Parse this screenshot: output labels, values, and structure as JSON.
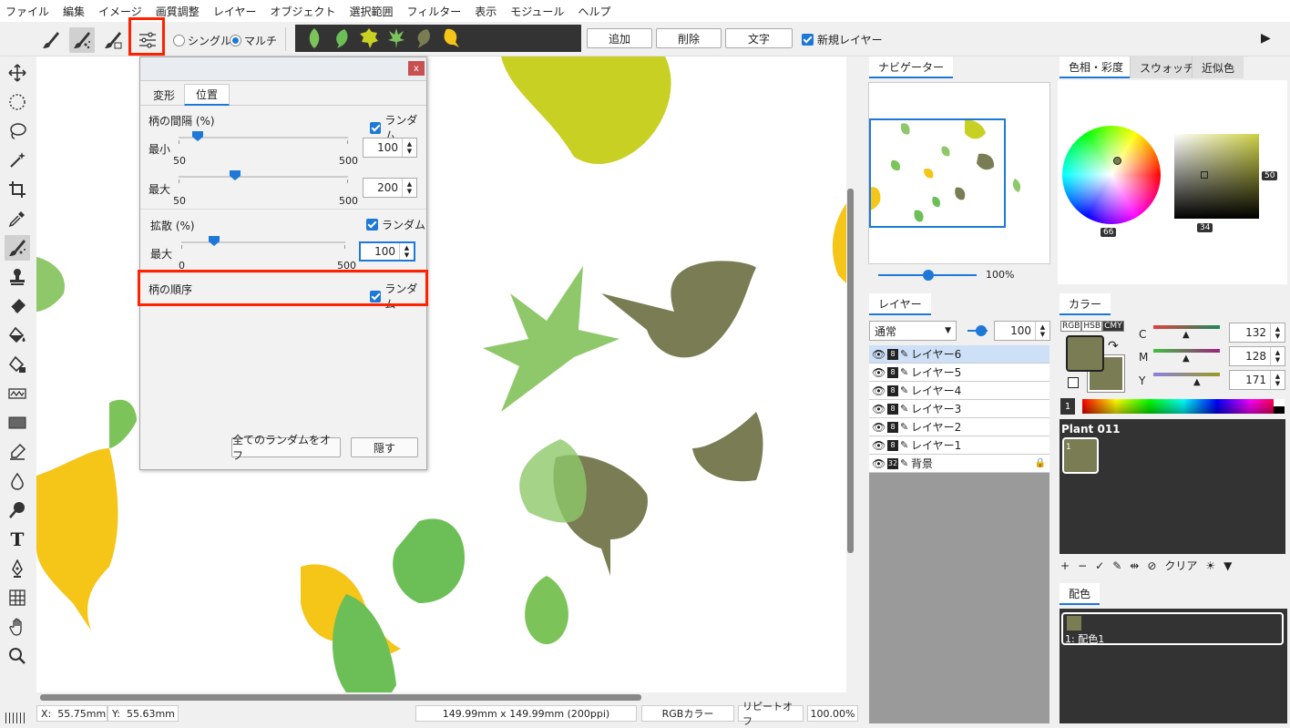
{
  "menu": [
    "ファイル",
    "編集",
    "イメージ",
    "画質調整",
    "レイヤー",
    "オブジェクト",
    "選択範囲",
    "フィルター",
    "表示",
    "モジュール",
    "ヘルプ"
  ],
  "toolbar": {
    "single_label": "シングル",
    "multi_label": "マルチ",
    "add_label": "追加",
    "delete_label": "削除",
    "text_label": "文字",
    "new_layer_label": "新規レイヤー",
    "leaf_colors": [
      "#7cc45a",
      "#6bbf56",
      "#c9d024",
      "#7cc45a",
      "#7a7d54",
      "#f5c518"
    ]
  },
  "dialog": {
    "close_label": "x",
    "tabs": [
      "変形",
      "位置"
    ],
    "spacing_label": "柄の間隔 (%)",
    "random_label": "ランダム",
    "min_label": "最小",
    "max_label": "最大",
    "min_value": "100",
    "max_value": "200",
    "range_start": "50",
    "range_end": "500",
    "scatter_label": "拡散 (%)",
    "scatter_max_label": "最大",
    "scatter_value": "100",
    "scatter_start": "0",
    "scatter_end": "500",
    "order_label": "柄の順序",
    "all_random_off": "全てのランダムをオフ",
    "hide_label": "隠す"
  },
  "navigator": {
    "tab": "ナビゲーター",
    "zoom": "100%"
  },
  "layers": {
    "tab": "レイヤー",
    "blend": "通常",
    "opacity": "100",
    "items": [
      {
        "name": "レイヤー6",
        "bits": "8"
      },
      {
        "name": "レイヤー5",
        "bits": "8"
      },
      {
        "name": "レイヤー4",
        "bits": "8"
      },
      {
        "name": "レイヤー3",
        "bits": "8"
      },
      {
        "name": "レイヤー2",
        "bits": "8"
      },
      {
        "name": "レイヤー1",
        "bits": "8"
      },
      {
        "name": "背景",
        "bits": "32"
      }
    ]
  },
  "color": {
    "tabs": [
      "色相・彩度",
      "スウォッチ",
      "近似色"
    ],
    "hue_value": "66",
    "sat_value": "34",
    "bright_value": "50",
    "color_tab": "カラー",
    "modes": [
      "RGB",
      "HSB",
      "CMY"
    ],
    "c_label": "C",
    "m_label": "M",
    "y_label": "Y",
    "c_value": "132",
    "m_value": "128",
    "y_value": "171",
    "fg_color": "#7a7d54",
    "palette_index": "1",
    "palette_name": "Plant 011",
    "swatch_index": "1",
    "clear_label": "クリア"
  },
  "scheme": {
    "tab": "配色",
    "item_label": "1: 配色1"
  },
  "status": {
    "x_label": "X:",
    "x_value": "55.75mm",
    "y_label": "Y:",
    "y_value": "55.63mm",
    "size": "149.99mm x 149.99mm (200ppi)",
    "color_mode": "RGBカラー",
    "repeat": "リピートオフ",
    "zoom": "100.00%"
  }
}
